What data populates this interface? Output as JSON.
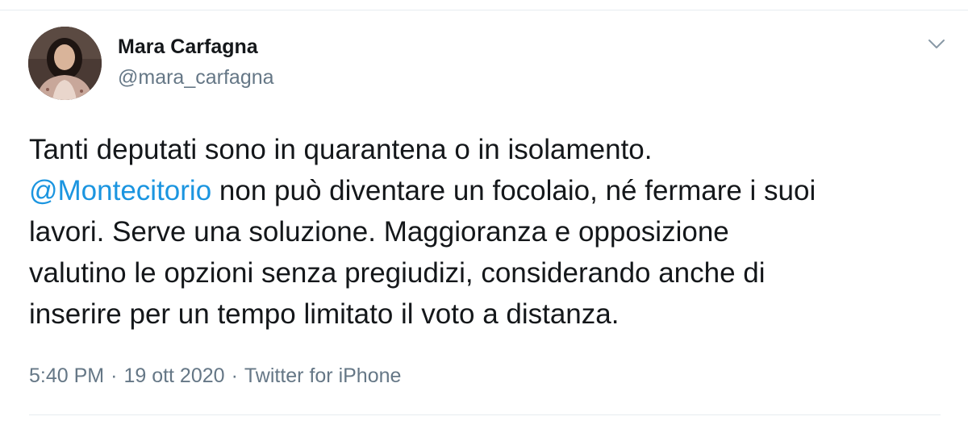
{
  "author": {
    "name": "Mara Carfagna",
    "handle": "@mara_carfagna"
  },
  "tweet": {
    "line1": "Tanti deputati sono in quarantena o in isolamento.",
    "mention": "@Montecitorio",
    "line2_rest": " non può diventare un focolaio, né fermare i suoi",
    "line3": "lavori. Serve una soluzione. Maggioranza e opposizione",
    "line4": "valutino le opzioni senza pregiudizi, considerando anche di",
    "line5": "inserire per un tempo limitato il voto a distanza."
  },
  "meta": {
    "time": "5:40 PM",
    "separator": "·",
    "date": "19 ott 2020",
    "source": "Twitter for iPhone"
  },
  "icons": {
    "caret": "chevron-down-icon"
  },
  "colors": {
    "text": "#14171a",
    "secondary": "#657786",
    "link": "#1b95e0",
    "divider": "#e6ecf0"
  }
}
